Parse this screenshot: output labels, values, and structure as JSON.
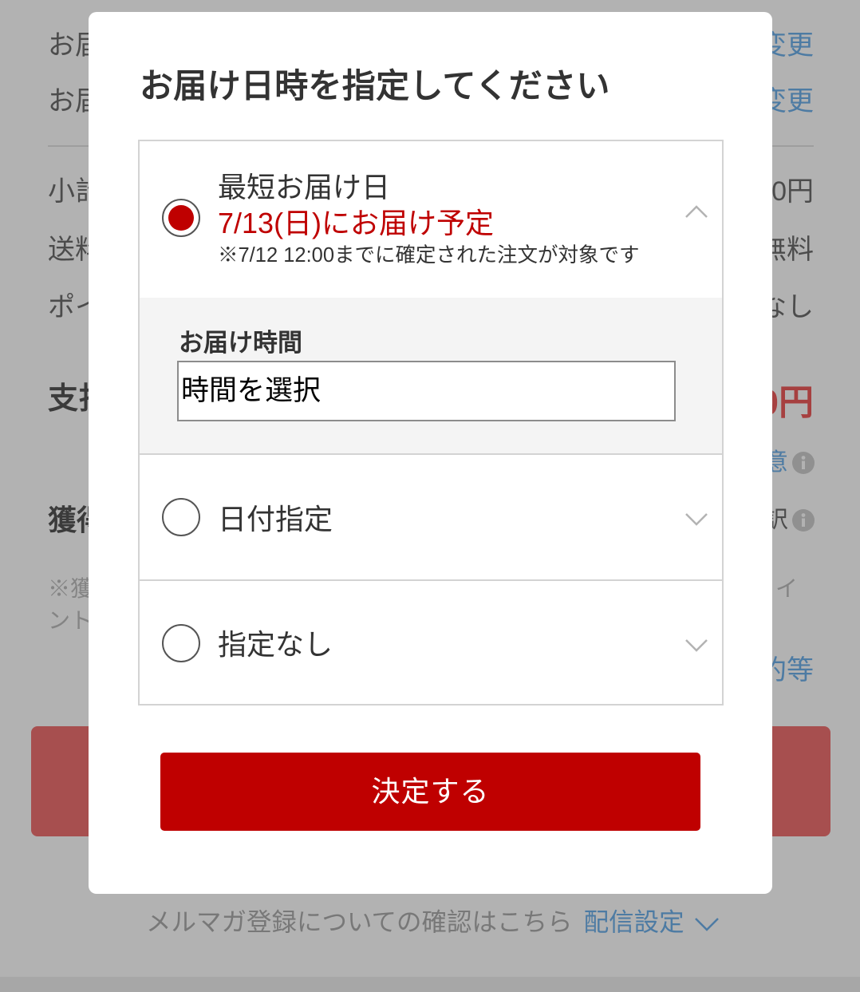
{
  "colors": {
    "accent_red": "#bf0000",
    "link_blue": "#6fb0ea",
    "text_dark": "#333333",
    "backdrop": "#0000004d"
  },
  "icons": {
    "expanded_toggle": "chevron-up-icon",
    "collapsed_toggle": "chevron-down-icon",
    "info": "info-icon",
    "newsletter_toggle": "chevron-down-icon"
  },
  "background_page": {
    "shipping_rows": [
      {
        "label": "お届",
        "action": "変更"
      },
      {
        "label": "お届",
        "action": "変更"
      }
    ],
    "summary_rows": [
      {
        "label": "小計",
        "value": "0円"
      },
      {
        "label": "送料",
        "value": "無料"
      },
      {
        "label": "ポイ",
        "value": "なし"
      }
    ],
    "total": {
      "label": "支払",
      "value": "0円"
    },
    "notice_link": "意",
    "points": {
      "label": "獲得",
      "detail": "訳"
    },
    "points_note": {
      "line1_start": "※獲",
      "line1_end": "イ",
      "line2": "ント"
    },
    "terms_link": "約等",
    "newsletter": {
      "text": "メルマガ登録についての確認はこちら",
      "link": "配信設定"
    }
  },
  "modal": {
    "title": "お届け日時を指定してください",
    "options": [
      {
        "label": "最短お届け日",
        "selected": true,
        "expanded": true,
        "date_text": "7/13(日)にお届け予定",
        "note": "※7/12 12:00までに確定された注文が対象です",
        "time_label": "お届け時間",
        "time_select": {
          "value": "時間を選択"
        }
      },
      {
        "label": "日付指定",
        "selected": false,
        "expanded": false
      },
      {
        "label": "指定なし",
        "selected": false,
        "expanded": false
      }
    ],
    "confirm_button": "決定する"
  }
}
